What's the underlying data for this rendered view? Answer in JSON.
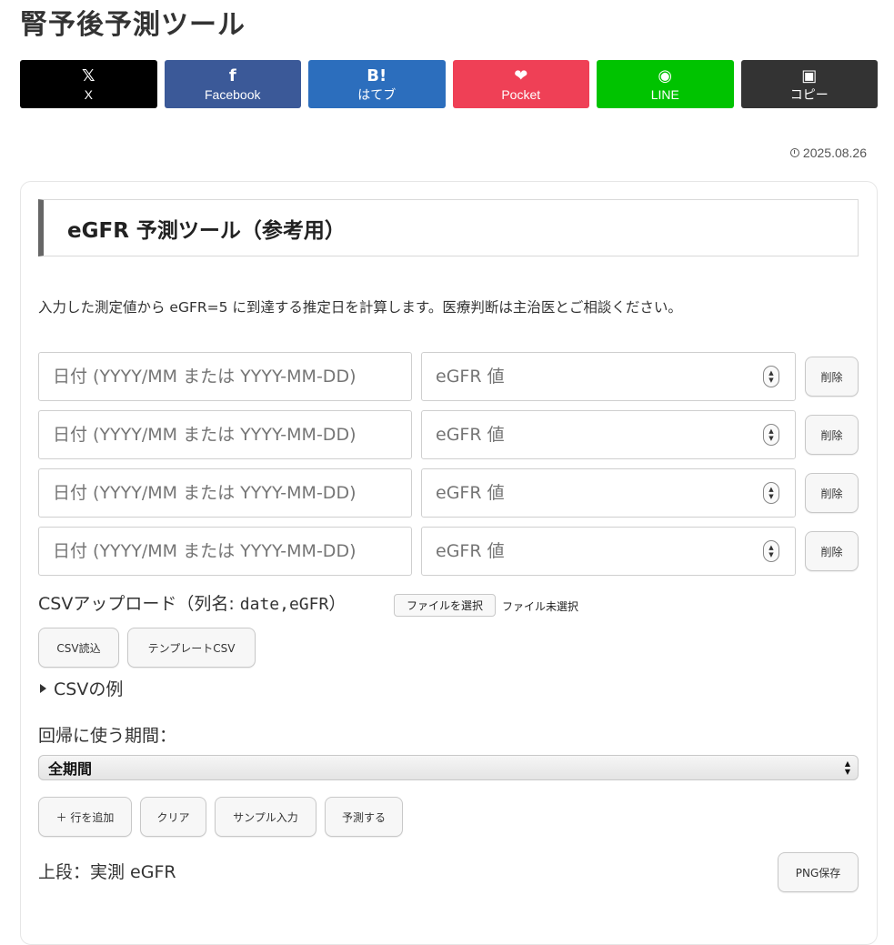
{
  "page_title": "腎予後予測ツール",
  "share": [
    {
      "icon": "𝕏",
      "label": "X",
      "bg": "#000000"
    },
    {
      "icon": "f",
      "label": "Facebook",
      "bg": "#3b5998"
    },
    {
      "icon": "B!",
      "label": "はてブ",
      "bg": "#2c6ebd"
    },
    {
      "icon": "❤",
      "label": "Pocket",
      "bg": "#ef4056"
    },
    {
      "icon": "◉",
      "label": "LINE",
      "bg": "#00c300"
    },
    {
      "icon": "▣",
      "label": "コピー",
      "bg": "#333333"
    }
  ],
  "post_date": "2025.08.26",
  "tool": {
    "title": "eGFR 予測ツール（参考用）",
    "description": "入力した測定値から eGFR=5 に到達する推定日を計算します。医療判断は主治医とご相談ください。"
  },
  "rows": [
    {
      "date_placeholder": "日付 (YYYY/MM または YYYY-MM-DD)",
      "egfr_placeholder": "eGFR 値",
      "delete_label": "削除"
    },
    {
      "date_placeholder": "日付 (YYYY/MM または YYYY-MM-DD)",
      "egfr_placeholder": "eGFR 値",
      "delete_label": "削除"
    },
    {
      "date_placeholder": "日付 (YYYY/MM または YYYY-MM-DD)",
      "egfr_placeholder": "eGFR 値",
      "delete_label": "削除"
    },
    {
      "date_placeholder": "日付 (YYYY/MM または YYYY-MM-DD)",
      "egfr_placeholder": "eGFR 値",
      "delete_label": "削除"
    }
  ],
  "csv": {
    "label_prefix": "CSVアップロード（列名: ",
    "label_code": "date,eGFR",
    "label_suffix": "）",
    "file_button": "ファイルを選択",
    "file_status": "ファイル未選択",
    "read_button": "CSV読込",
    "template_button": "テンプレートCSV",
    "example_summary": "CSVの例"
  },
  "period": {
    "label": "回帰に使う期間：",
    "selected": "全期間"
  },
  "actions": {
    "add_row": "＋ 行を追加",
    "clear": "クリア",
    "sample": "サンプル入力",
    "predict": "予測する"
  },
  "chart": {
    "caption": "上段：実測 eGFR",
    "save_png": "PNG保存"
  }
}
